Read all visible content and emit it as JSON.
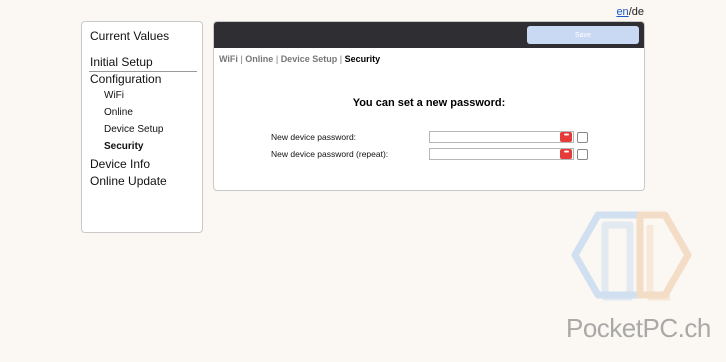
{
  "lang": {
    "en": "en",
    "sep": "/",
    "de": "de"
  },
  "sidebar": {
    "current_values": "Current Values",
    "initial_setup": "Initial Setup",
    "configuration": "Configuration",
    "wifi": "WiFi",
    "online": "Online",
    "device_setup": "Device Setup",
    "security": "Security",
    "device_info": "Device Info",
    "online_update": "Online Update"
  },
  "toolbar": {
    "save_label": "Save"
  },
  "breadcrumb": {
    "wifi": "WiFi",
    "online": "Online",
    "device_setup": "Device Setup",
    "security": "Security",
    "sep": "|"
  },
  "form": {
    "heading": "You can set a new password:",
    "password_label": "New device password:",
    "password_repeat_label": "New device password (repeat):",
    "password_value": "",
    "password_repeat_value": "",
    "icon_glyph": "•••"
  },
  "watermark": {
    "text": "PocketPC.ch"
  },
  "colors": {
    "accent": "#e53b3b",
    "topbar": "#2f2f33",
    "save_button": "#c9d9f3",
    "link": "#1a56c4"
  }
}
